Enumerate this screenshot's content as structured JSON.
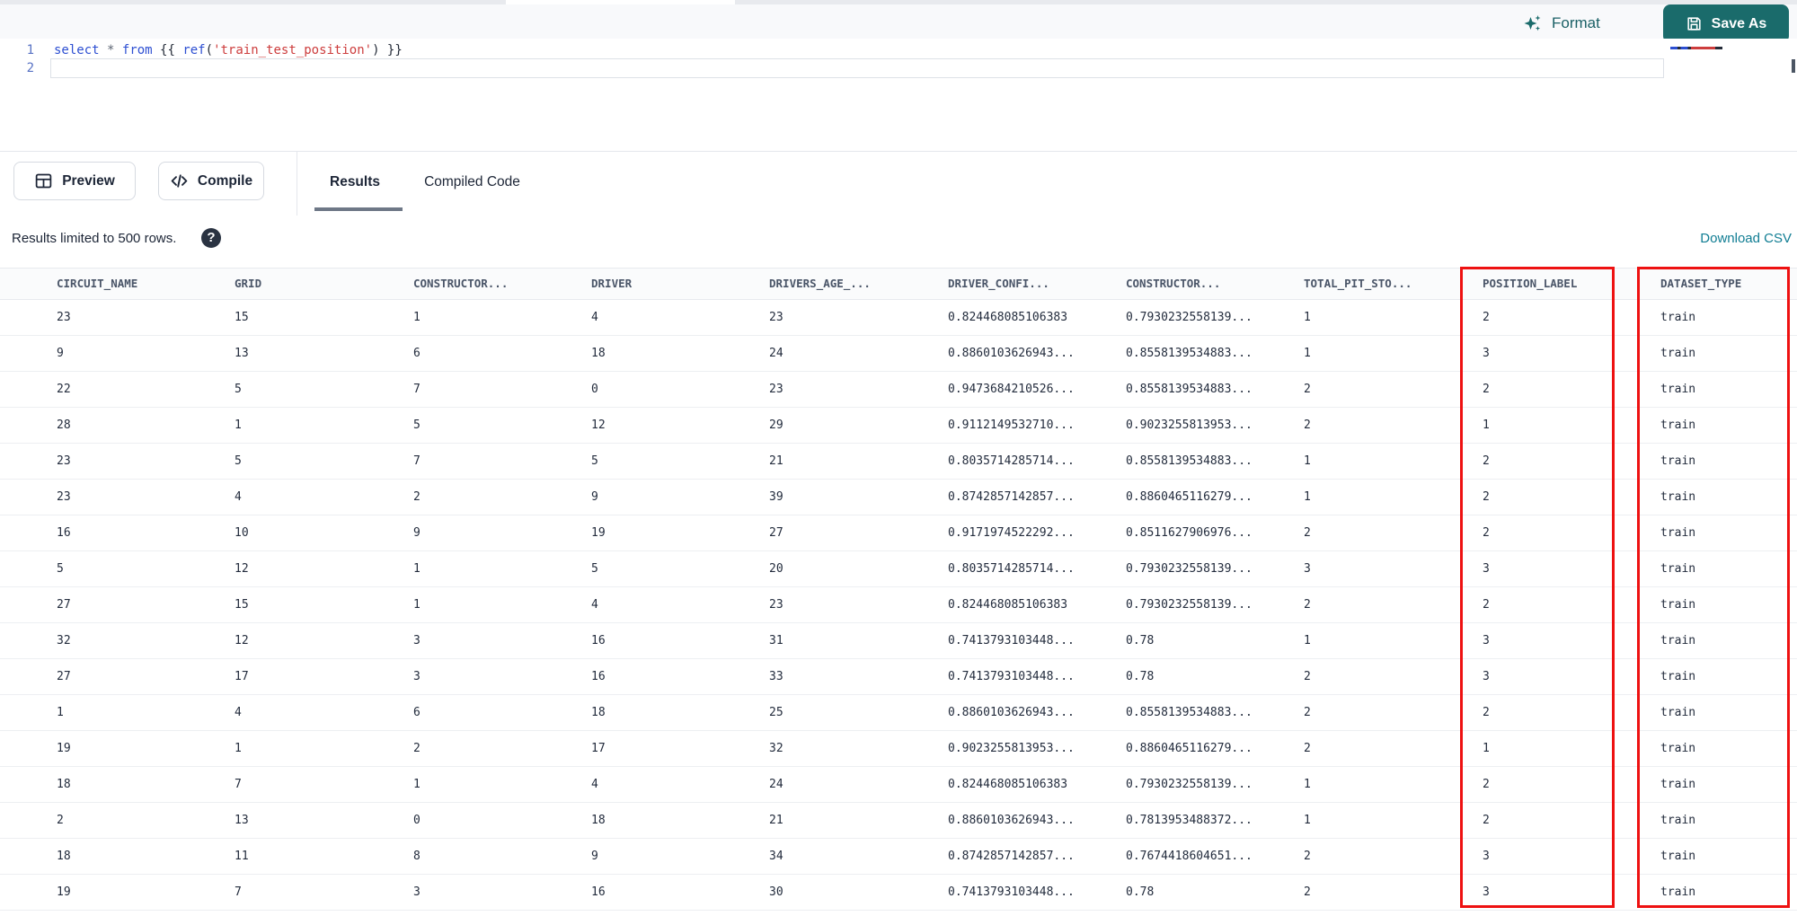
{
  "editor": {
    "lines": [
      {
        "number": "1",
        "tokens": [
          {
            "text": "select",
            "type": "kw"
          },
          {
            "text": " ",
            "type": "pl"
          },
          {
            "text": "*",
            "type": "op"
          },
          {
            "text": " ",
            "type": "pl"
          },
          {
            "text": "from",
            "type": "kw"
          },
          {
            "text": " {{ ",
            "type": "pl"
          },
          {
            "text": "ref",
            "type": "kw"
          },
          {
            "text": "(",
            "type": "pl"
          },
          {
            "text": "'train_test_position'",
            "type": "str"
          },
          {
            "text": ") }}",
            "type": "pl"
          }
        ]
      },
      {
        "number": "2",
        "tokens": []
      }
    ]
  },
  "toolbar": {
    "format_label": "Format",
    "save_as_label": "Save As"
  },
  "actionbar": {
    "preview_label": "Preview",
    "compile_label": "Compile",
    "tabs": [
      {
        "label": "Results",
        "active": true
      },
      {
        "label": "Compiled Code",
        "active": false
      }
    ]
  },
  "resultsbar": {
    "limit_text": "Results limited to 500 rows.",
    "help_glyph": "?",
    "download_label": "Download CSV"
  },
  "table": {
    "columns": [
      "CIRCUIT_NAME",
      "GRID",
      "CONSTRUCTOR...",
      "DRIVER",
      "DRIVERS_AGE_...",
      "DRIVER_CONFI...",
      "CONSTRUCTOR...",
      "TOTAL_PIT_STO...",
      "POSITION_LABEL",
      "DATASET_TYPE"
    ],
    "highlighted_columns": [
      "POSITION_LABEL",
      "DATASET_TYPE"
    ],
    "rows": [
      [
        "23",
        "15",
        "1",
        "4",
        "23",
        "0.824468085106383",
        "0.7930232558139...",
        "1",
        "2",
        "train"
      ],
      [
        "9",
        "13",
        "6",
        "18",
        "24",
        "0.8860103626943...",
        "0.8558139534883...",
        "1",
        "3",
        "train"
      ],
      [
        "22",
        "5",
        "7",
        "0",
        "23",
        "0.9473684210526...",
        "0.8558139534883...",
        "2",
        "2",
        "train"
      ],
      [
        "28",
        "1",
        "5",
        "12",
        "29",
        "0.9112149532710...",
        "0.9023255813953...",
        "2",
        "1",
        "train"
      ],
      [
        "23",
        "5",
        "7",
        "5",
        "21",
        "0.8035714285714...",
        "0.8558139534883...",
        "1",
        "2",
        "train"
      ],
      [
        "23",
        "4",
        "2",
        "9",
        "39",
        "0.8742857142857...",
        "0.8860465116279...",
        "1",
        "2",
        "train"
      ],
      [
        "16",
        "10",
        "9",
        "19",
        "27",
        "0.9171974522292...",
        "0.8511627906976...",
        "2",
        "2",
        "train"
      ],
      [
        "5",
        "12",
        "1",
        "5",
        "20",
        "0.8035714285714...",
        "0.7930232558139...",
        "3",
        "3",
        "train"
      ],
      [
        "27",
        "15",
        "1",
        "4",
        "23",
        "0.824468085106383",
        "0.7930232558139...",
        "2",
        "2",
        "train"
      ],
      [
        "32",
        "12",
        "3",
        "16",
        "31",
        "0.7413793103448...",
        "0.78",
        "1",
        "3",
        "train"
      ],
      [
        "27",
        "17",
        "3",
        "16",
        "33",
        "0.7413793103448...",
        "0.78",
        "2",
        "3",
        "train"
      ],
      [
        "1",
        "4",
        "6",
        "18",
        "25",
        "0.8860103626943...",
        "0.8558139534883...",
        "2",
        "2",
        "train"
      ],
      [
        "19",
        "1",
        "2",
        "17",
        "32",
        "0.9023255813953...",
        "0.8860465116279...",
        "2",
        "1",
        "train"
      ],
      [
        "18",
        "7",
        "1",
        "4",
        "24",
        "0.824468085106383",
        "0.7930232558139...",
        "1",
        "2",
        "train"
      ],
      [
        "2",
        "13",
        "0",
        "18",
        "21",
        "0.8860103626943...",
        "0.7813953488372...",
        "1",
        "2",
        "train"
      ],
      [
        "18",
        "11",
        "8",
        "9",
        "34",
        "0.8742857142857...",
        "0.7674418604651...",
        "2",
        "3",
        "train"
      ],
      [
        "19",
        "7",
        "3",
        "16",
        "30",
        "0.7413793103448...",
        "0.78",
        "2",
        "3",
        "train"
      ]
    ]
  },
  "colors": {
    "accent_teal": "#1a6b6b",
    "link_teal": "#107d93",
    "highlight_red": "#ee1111",
    "keyword_blue": "#2d4fd2",
    "string_red": "#cd3d3d"
  }
}
